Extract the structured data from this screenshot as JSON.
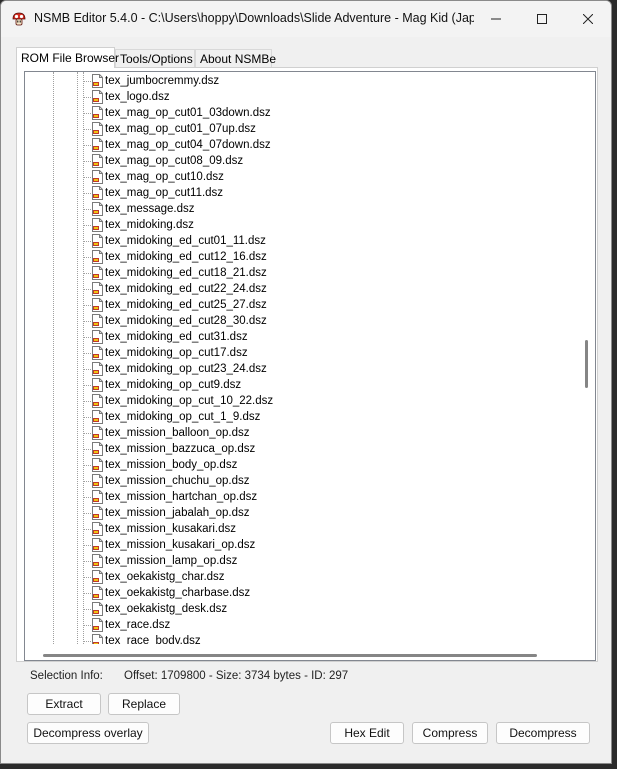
{
  "window": {
    "title": "NSMB Editor 5.4.0 - C:\\Users\\hoppy\\Downloads\\Slide Adventure - Mag Kid (Japa..."
  },
  "tabs": [
    {
      "label": "ROM File Browser",
      "active": true
    },
    {
      "label": "Tools/Options",
      "active": false
    },
    {
      "label": "About NSMBe",
      "active": false
    }
  ],
  "files": [
    "tex_jumbocremmy.dsz",
    "tex_logo.dsz",
    "tex_mag_op_cut01_03down.dsz",
    "tex_mag_op_cut01_07up.dsz",
    "tex_mag_op_cut04_07down.dsz",
    "tex_mag_op_cut08_09.dsz",
    "tex_mag_op_cut10.dsz",
    "tex_mag_op_cut11.dsz",
    "tex_message.dsz",
    "tex_midoking.dsz",
    "tex_midoking_ed_cut01_11.dsz",
    "tex_midoking_ed_cut12_16.dsz",
    "tex_midoking_ed_cut18_21.dsz",
    "tex_midoking_ed_cut22_24.dsz",
    "tex_midoking_ed_cut25_27.dsz",
    "tex_midoking_ed_cut28_30.dsz",
    "tex_midoking_ed_cut31.dsz",
    "tex_midoking_op_cut17.dsz",
    "tex_midoking_op_cut23_24.dsz",
    "tex_midoking_op_cut9.dsz",
    "tex_midoking_op_cut_10_22.dsz",
    "tex_midoking_op_cut_1_9.dsz",
    "tex_mission_balloon_op.dsz",
    "tex_mission_bazzuca_op.dsz",
    "tex_mission_body_op.dsz",
    "tex_mission_chuchu_op.dsz",
    "tex_mission_hartchan_op.dsz",
    "tex_mission_jabalah_op.dsz",
    "tex_mission_kusakari.dsz",
    "tex_mission_kusakari_op.dsz",
    "tex_mission_lamp_op.dsz",
    "tex_oekakistg_char.dsz",
    "tex_oekakistg_charbase.dsz",
    "tex_oekakistg_desk.dsz",
    "tex_race.dsz",
    "tex_race_body.dsz"
  ],
  "selection": {
    "label": "Selection Info:",
    "value": "Offset: 1709800 - Size: 3734 bytes - ID: 297"
  },
  "buttons": {
    "extract": "Extract",
    "replace": "Replace",
    "decompress_overlay": "Decompress overlay",
    "hex_edit": "Hex Edit",
    "compress": "Compress",
    "decompress": "Decompress"
  },
  "colors": {
    "window_bg": "#f0f0f0",
    "file_icon_red": "#c0392b"
  }
}
